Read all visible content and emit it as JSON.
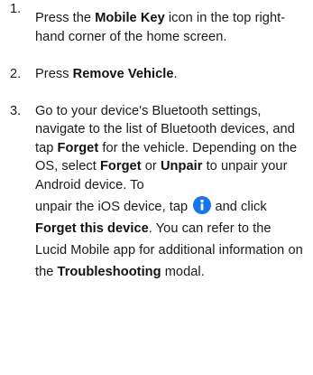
{
  "steps": [
    {
      "number": "1.",
      "t1": "Press the ",
      "b1": "Mobile Key",
      "t2": " icon in the top right-hand corner of the home screen."
    },
    {
      "number": "2.",
      "t1": "Press ",
      "b1": "Remove Vehicle",
      "t2": "."
    },
    {
      "number": "3.",
      "t1": "Go to your device's Bluetooth settings, navigate to the list of Bluetooth devices, and tap ",
      "b1": "Forget",
      "t2": " for the vehicle. Depending on the OS, select ",
      "b2": "Forget",
      "t3": " or ",
      "b3": "Unpair",
      "t4": " to unpair your Android device. To",
      "t5": "unpair the iOS device, tap ",
      "t6": " and click ",
      "b4": "Forget this device",
      "t7": ". You can refer to the Lucid Mobile app for additional information on the ",
      "b5": "Troubleshooting",
      "t8": " modal."
    }
  ],
  "icons": {
    "info": "info-icon",
    "info_color": "#1976e8"
  }
}
